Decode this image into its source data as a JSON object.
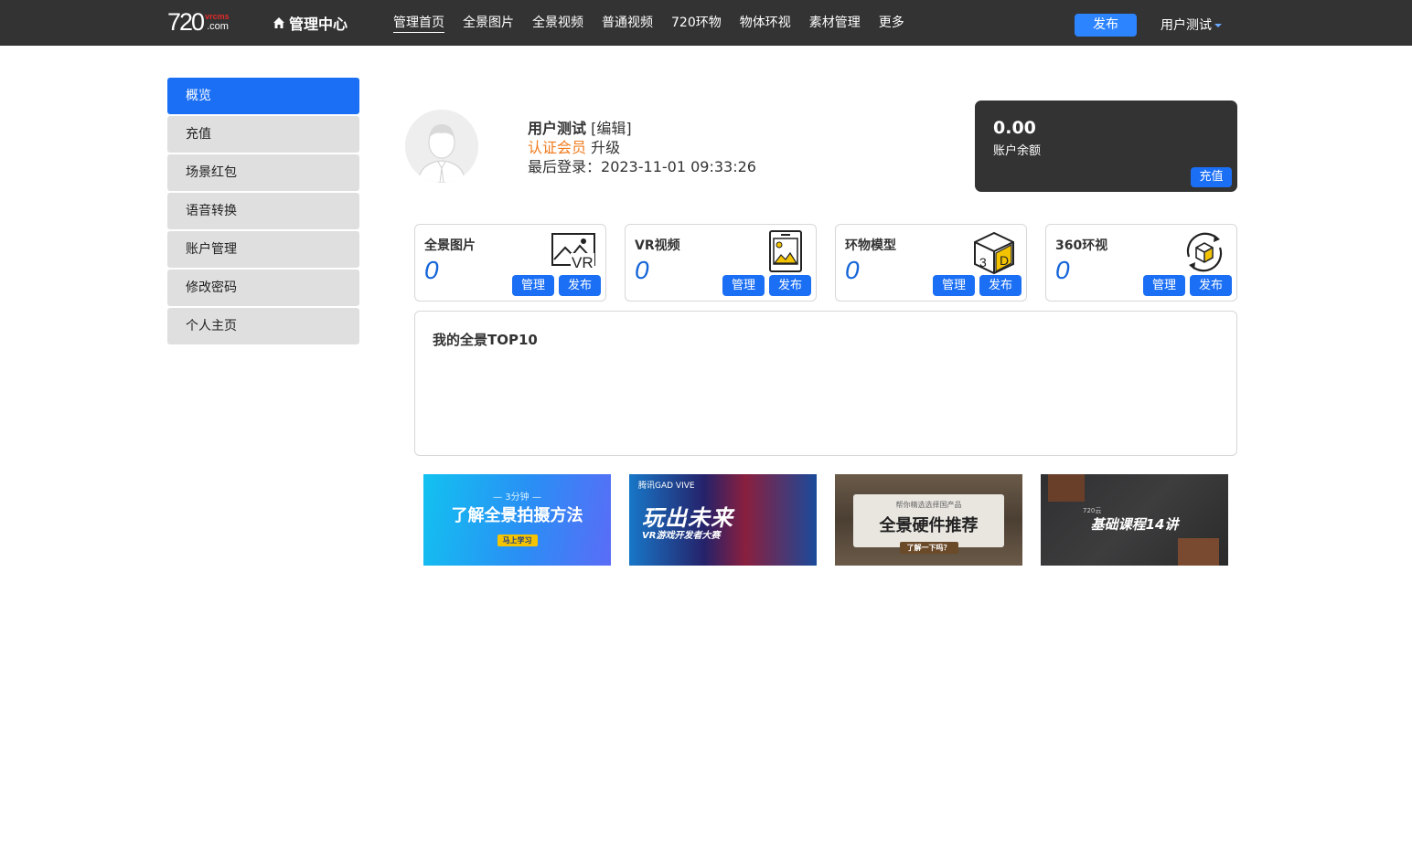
{
  "header": {
    "logo_num": "720",
    "logo_brand": "vrcms",
    "logo_com": ".com",
    "center_title": "管理中心",
    "nav": [
      "管理首页",
      "全景图片",
      "全景视频",
      "普通视频",
      "720环物",
      "物体环视",
      "素材管理",
      "更多"
    ],
    "publish": "发布",
    "user": "用户测试"
  },
  "sidebar": {
    "items": [
      {
        "label": "概览"
      },
      {
        "label": "充值"
      },
      {
        "label": "场景红包"
      },
      {
        "label": "语音转换"
      },
      {
        "label": "账户管理"
      },
      {
        "label": "修改密码"
      },
      {
        "label": "个人主页"
      }
    ]
  },
  "profile": {
    "name": "用户测试",
    "edit": "[编辑]",
    "member": "认证会员",
    "upgrade": "升级",
    "last_login_label": "最后登录：",
    "last_login": "2023-11-01 09:33:26"
  },
  "balance": {
    "amount": "0.00",
    "label": "账户余额",
    "recharge": "充值"
  },
  "cards": [
    {
      "title": "全景图片",
      "count": "0",
      "manage": "管理",
      "publish": "发布",
      "icon": "vr-image-icon"
    },
    {
      "title": "VR视频",
      "count": "0",
      "manage": "管理",
      "publish": "发布",
      "icon": "tablet-image-icon"
    },
    {
      "title": "环物模型",
      "count": "0",
      "manage": "管理",
      "publish": "发布",
      "icon": "3d-cube-icon"
    },
    {
      "title": "360环视",
      "count": "0",
      "manage": "管理",
      "publish": "发布",
      "icon": "rotate-360-icon"
    }
  ],
  "top10": {
    "title": "我的全景TOP10"
  },
  "banners": [
    {
      "top": "— 3分钟 —",
      "main": "了解全景拍摄方法",
      "sub": "马上学习"
    },
    {
      "top": "腾讯GAD  VIVE",
      "main": "玩出未来",
      "sub": "VR游戏开发者大赛"
    },
    {
      "top": "帮你精选选择国产品",
      "main": "全景硬件推荐",
      "sub": "了解一下吗？"
    },
    {
      "top": "720云",
      "main": "基础课程14讲",
      "sub": ""
    }
  ],
  "colors": {
    "topbar": "#333333",
    "accent": "#1b6ff5",
    "member": "#f07b1d",
    "count": "#1565d8"
  }
}
